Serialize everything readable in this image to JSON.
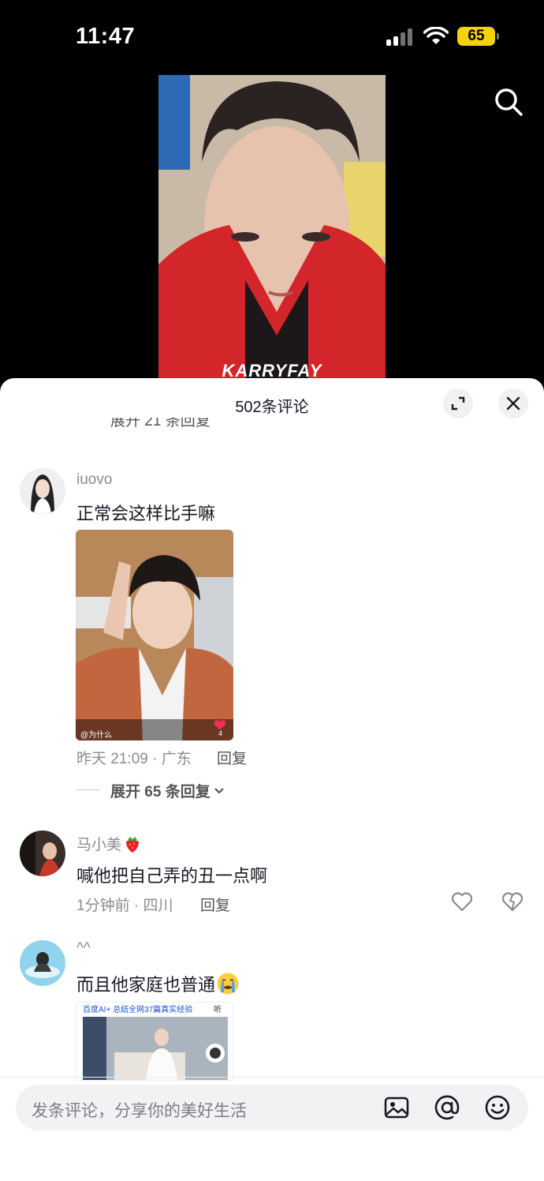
{
  "status_bar": {
    "time": "11:47",
    "battery": "65"
  },
  "video": {
    "logo_text": "KARRYFAY"
  },
  "sheet": {
    "title": "502条评论",
    "clipped_reply_label": "展开 21 条回复"
  },
  "comments": [
    {
      "username": "iuovo",
      "text": "正常会这样比手嘛",
      "image_caption": "@为什么",
      "image_likes": "4",
      "meta": "昨天 21:09 · 广东",
      "reply_label": "回复",
      "expand_label": "展开 65 条回复"
    },
    {
      "username": "马小美",
      "text": "喊他把自己弄的丑一点啊",
      "meta": "1分钟前 · 四川",
      "reply_label": "回复"
    },
    {
      "username": "^^",
      "text": "而且他家庭也普通",
      "image_header_left": "百度AI+ 总结全网37篇真实经验",
      "image_header_right": "听"
    }
  ],
  "input": {
    "placeholder": "发条评论，分享你的美好生活"
  },
  "icons": {
    "search": "search-icon",
    "expand": "expand-icon",
    "close": "close-icon",
    "heart": "heart-icon",
    "dislike": "broken-heart-icon",
    "image": "image-icon",
    "at": "at-icon",
    "emoji": "emoji-icon"
  },
  "colors": {
    "battery": "#f5d20a",
    "like_red": "#fe2c55"
  }
}
